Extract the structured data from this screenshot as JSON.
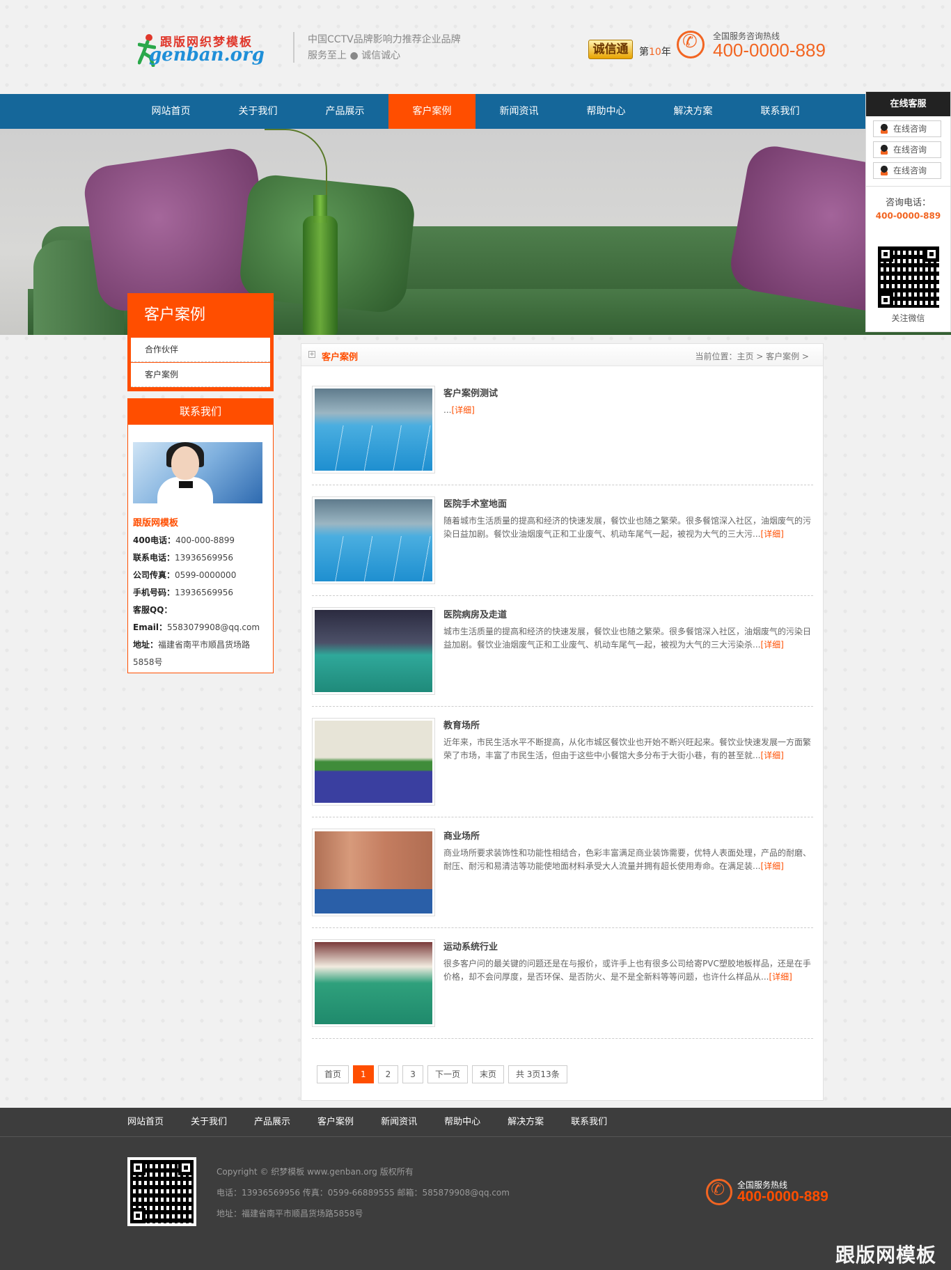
{
  "header": {
    "logo_cn": "跟版网织梦模板",
    "logo_en": "genban.org",
    "slogan_line1": "中国CCTV品牌影响力推荐企业品牌",
    "slogan_line2": "服务至上 ● 诚信诚心",
    "badge": "诚信通",
    "years_prefix": "第",
    "years_num": "10",
    "years_suffix": "年",
    "hotline_label": "全国服务咨询热线",
    "hotline": "400-0000-889"
  },
  "nav": {
    "items": [
      "网站首页",
      "关于我们",
      "产品展示",
      "客户案例",
      "新闻资讯",
      "帮助中心",
      "解决方案",
      "联系我们"
    ],
    "active_index": 3
  },
  "left": {
    "title": "客户案例",
    "menu": [
      "合作伙伴",
      "客户案例"
    ],
    "contact": {
      "heading": "联系我们",
      "company": "跟版网模板",
      "lines": [
        {
          "label": "400电话：",
          "value": "400-000-8899"
        },
        {
          "label": "联系电话：",
          "value": "13936569956"
        },
        {
          "label": "公司传真：",
          "value": "0599-0000000"
        },
        {
          "label": "手机号码：",
          "value": "13936569956"
        },
        {
          "label": "客服QQ：",
          "value": ""
        },
        {
          "label": "Email：",
          "value": "5583079908@qq.com"
        },
        {
          "label": "地址：",
          "value": "福建省南平市顺昌货场路5858号"
        }
      ]
    }
  },
  "main": {
    "title": "客户案例",
    "breadcrumb": "当前位置：主页 > 客户案例 >",
    "more_label": "[详细]",
    "cases": [
      {
        "title": "客户案例测试",
        "desc": "...",
        "image": "gym"
      },
      {
        "title": "医院手术室地面",
        "desc": "随着城市生活质量的提高和经济的快速发展，餐饮业也随之繁荣。很多餐馆深入社区，油烟废气的污染日益加剧。餐饮业油烟废气正和工业废气、机动车尾气一起，被视为大气的三大污...",
        "image": "gym"
      },
      {
        "title": "医院病房及走道",
        "desc": "城市生活质量的提高和经济的快速发展，餐饮业也随之繁荣。很多餐馆深入社区，油烟废气的污染日益加剧。餐饮业油烟废气正和工业废气、机动车尾气一起，被视为大气的三大污染杀...",
        "image": "ward"
      },
      {
        "title": "教育场所",
        "desc": "近年来，市民生活水平不断提高，从化市城区餐饮业也开始不断兴旺起来。餐饮业快速发展一方面繁荣了市场，丰富了市民生活，但由于这些中小餐馆大多分布于大街小巷，有的甚至就...",
        "image": "edu"
      },
      {
        "title": "商业场所",
        "desc": "商业场所要求装饰性和功能性相结合，色彩丰富满足商业装饰需要，优特人表面处理，产品的耐磨、耐压、耐污和易清洁等功能使地面材料承受大人流量并拥有超长使用寿命。在满足装...",
        "image": "biz"
      },
      {
        "title": "运动系统行业",
        "desc": "很多客户问的最关键的问题还是在与报价，或许手上也有很多公司给寄PVC塑胶地板样品，还是在手价格，却不会问厚度，是否环保、是否防火、是不是全新料等等问题，也许什么样品从...",
        "image": "sport"
      }
    ],
    "pager": {
      "first": "首页",
      "pages": [
        "1",
        "2",
        "3"
      ],
      "current": "1",
      "next": "下一页",
      "last": "末页",
      "summary": "共 3页13条"
    }
  },
  "float_service": {
    "title": "在线客服",
    "qq_items": [
      "在线咨询",
      "在线咨询",
      "在线咨询"
    ],
    "tel_label": "咨询电话：",
    "tel": "400-0000-889",
    "qr_label": "关注微信"
  },
  "footer": {
    "nav": [
      "网站首页",
      "关于我们",
      "产品展示",
      "客户案例",
      "新闻资讯",
      "帮助中心",
      "解决方案",
      "联系我们"
    ],
    "copyright": "Copyright © 织梦模板 www.genban.org 版权所有",
    "contact": "电话：13936569956 传真：0599-66889555 邮箱：585879908@qq.com",
    "address": "地址：福建省南平市顺昌货场路5858号",
    "hotline_label": "全国服务热线",
    "hotline": "400-0000-889",
    "watermark": "跟版网模板"
  },
  "colors": {
    "accent": "#ff4e00",
    "nav": "#15679a",
    "footer": "#3d3d3d",
    "hotline": "#f26522"
  }
}
